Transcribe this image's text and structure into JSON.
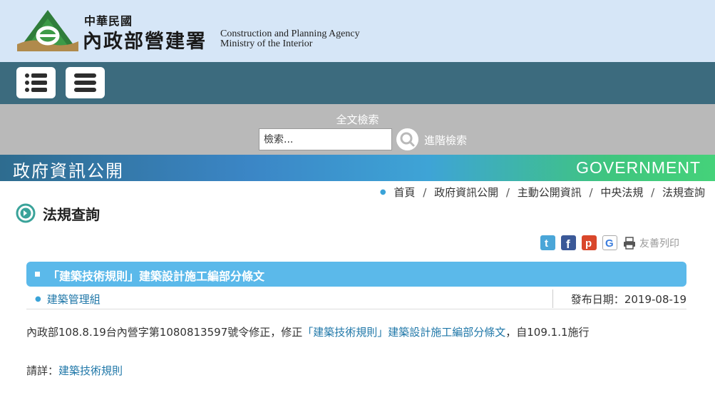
{
  "header": {
    "org_top": "中華民國",
    "org_main": "內政部營建署",
    "org_en_line1": "Construction and Planning Agency",
    "org_en_line2": "Ministry of the Interior"
  },
  "navbar": {
    "menu_icon_1": "list-icon",
    "menu_icon_2": "hamburger-icon"
  },
  "search": {
    "title": "全文檢索",
    "placeholder": "檢索...",
    "button_icon": "search-icon",
    "advanced_label": "進階檢索"
  },
  "banner": {
    "title_zh": "政府資訊公開",
    "title_en": "GOVERNMENT"
  },
  "breadcrumb": {
    "items": [
      "首頁",
      "政府資訊公開",
      "主動公開資訊",
      "中央法規",
      "法規查詢"
    ]
  },
  "page": {
    "title": "法規查詢"
  },
  "share": {
    "icons": [
      "twitter-icon",
      "facebook-icon",
      "plurk-icon",
      "google-icon",
      "print-icon"
    ],
    "print_label": "友善列印"
  },
  "article": {
    "title": "「建築技術規則」建築設計施工編部分條文",
    "unit": "建築管理組",
    "date_label": "發布日期：",
    "date_value": "2019-08-19",
    "content_prefix": "內政部108.8.19台內營字第1080813597號令修正，修正",
    "content_link": "「建築技術規則」建築設計施工編部分條文",
    "content_suffix": "，自109.1.1施行",
    "detail_label": "請詳：",
    "detail_link": "建築技術規則"
  },
  "colors": {
    "header_bg": "#d6e6f7",
    "nav_bg": "#3c6b7e",
    "search_bg": "#b9b9b9",
    "article_bar": "#5bb9ea",
    "link": "#1f77a8"
  }
}
